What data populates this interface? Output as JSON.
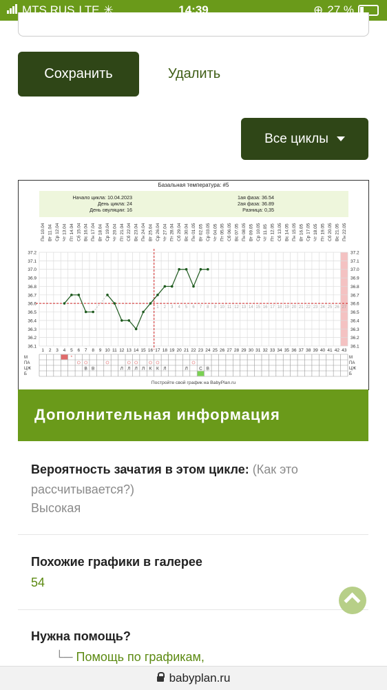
{
  "status_bar": {
    "carrier": "MTS RUS",
    "network": "LTE",
    "time": "14:39",
    "battery": "27 %"
  },
  "actions": {
    "save": "Сохранить",
    "delete": "Удалить",
    "all_cycles": "Все циклы"
  },
  "chart_data": {
    "type": "line",
    "title": "Базальная температура: #5",
    "info_left": [
      "Начало цикла: 10.04.2023",
      "День цикла: 24",
      "День овуляции: 16"
    ],
    "info_right": [
      "1ая фаза: 36.54",
      "2ая фаза: 36.89",
      "Разница: 0,35"
    ],
    "dates": [
      "10.04",
      "11.04",
      "12.04",
      "13.04",
      "14.04",
      "15.04",
      "16.04",
      "17.04",
      "18.04",
      "19.04",
      "20.04",
      "21.04",
      "22.04",
      "23.04",
      "24.04",
      "25.04",
      "26.04",
      "27.04",
      "28.04",
      "29.04",
      "30.04",
      "01.05",
      "02.05",
      "03.05",
      "04.05",
      "05.05",
      "06.05",
      "07.05",
      "08.05",
      "09.05",
      "10.05",
      "11.05",
      "12.05",
      "13.05",
      "14.05",
      "15.05",
      "16.05",
      "17.05",
      "18.05",
      "19.05",
      "20.05",
      "21.05",
      "22.05"
    ],
    "weekdays": [
      "Пн",
      "Вт",
      "Ср",
      "Чт",
      "Пт",
      "Сб",
      "Вс",
      "Пн",
      "Вт",
      "Ср",
      "Чт",
      "Пт",
      "Сб",
      "Вс",
      "Пн",
      "Вт",
      "Ср",
      "Чт",
      "Пт",
      "Сб",
      "Вс",
      "Пн",
      "Вт",
      "Ср",
      "Чт",
      "Пт",
      "Сб",
      "Вс",
      "Пн",
      "Вт",
      "Ср",
      "Чт",
      "Пт",
      "Сб",
      "Вс",
      "Пн",
      "Вт",
      "Ср",
      "Чт",
      "Пт",
      "Сб",
      "Вс",
      "Пн"
    ],
    "x": [
      1,
      2,
      3,
      4,
      5,
      6,
      7,
      8,
      9,
      10,
      11,
      12,
      13,
      14,
      15,
      16,
      17,
      18,
      19,
      20,
      21,
      22,
      23,
      24,
      25,
      26,
      27,
      28,
      29,
      30,
      31,
      32,
      33,
      34,
      35,
      36,
      37,
      38,
      39,
      40,
      41,
      42,
      43
    ],
    "temperatures": [
      null,
      null,
      null,
      36.6,
      36.7,
      36.7,
      36.5,
      36.5,
      null,
      36.7,
      36.6,
      36.4,
      36.4,
      36.3,
      36.5,
      36.6,
      36.7,
      36.8,
      36.8,
      37.0,
      37.0,
      36.8,
      37.0,
      37.0
    ],
    "y_ticks": [
      "37.2",
      "37.1",
      "37.0",
      "36.9",
      "36.8",
      "36.7",
      "36.6",
      "36.5",
      "36.4",
      "36.3",
      "36.2",
      "36.1"
    ],
    "ylim": [
      36.1,
      37.2
    ],
    "coverline": 36.6,
    "ovulation_day": 16,
    "post_ovulation_days": [
      "1",
      "2",
      "3",
      "4",
      "5",
      "6",
      "7",
      "8",
      "9",
      "10",
      "11",
      "12",
      "13",
      "14",
      "15",
      "16",
      "17",
      "18",
      "19",
      "20",
      "21",
      "22",
      "23",
      "24",
      "25",
      "26",
      "27"
    ],
    "row_labels": [
      "М",
      "ПА",
      "ЦЖ",
      "Б"
    ],
    "row_m": {
      "menstruation_days": [
        4
      ],
      "asterisk_days": [
        5
      ]
    },
    "row_pa_circles": [
      6,
      7,
      10,
      13,
      14,
      16,
      17,
      22
    ],
    "row_cj": [
      "",
      "",
      "",
      "",
      "",
      "",
      "В",
      "В",
      "",
      "",
      "",
      "Л",
      "Л",
      "Л",
      "Л",
      "К",
      "К",
      "Л",
      "",
      "",
      "Л",
      "",
      "С",
      "В"
    ],
    "row_b_marked": [
      23
    ],
    "footer": "Постройте свой график на BabyPlan.ru",
    "colors": {
      "line": "#1e5a1e",
      "coverline": "#d02020",
      "info_bg": "#eef6dc",
      "pink": "#f4c2c2",
      "menstruation": "#e06a6a",
      "b_mark": "#7ad152"
    }
  },
  "additional": {
    "heading": "Дополнительная информация",
    "probability_label": "Вероятность зачатия в этом цикле:",
    "probability_link": "(Как это рассчитывается?)",
    "probability_value": "Высокая",
    "similar_label": "Похожие графики в галерее",
    "similar_value": "54",
    "help_label": "Нужна помощь?",
    "help_link": "Помощь по графикам,"
  },
  "url_bar": {
    "domain": "babyplan.ru"
  }
}
